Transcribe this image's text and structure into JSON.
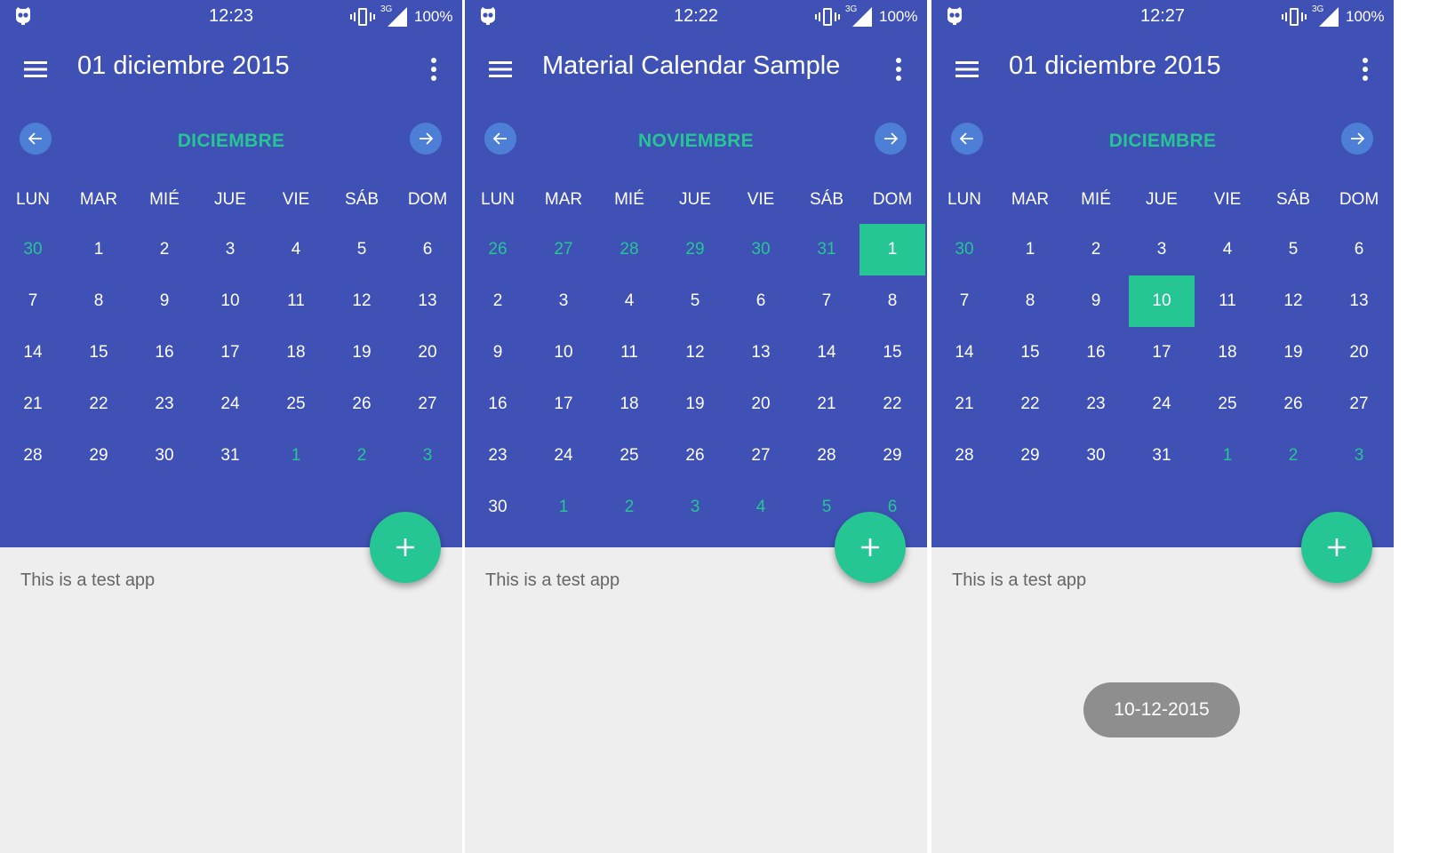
{
  "common": {
    "battery": "100%",
    "network_type": "3G",
    "weekdays": [
      "LUN",
      "MAR",
      "MIÉ",
      "JUE",
      "VIE",
      "SÁB",
      "DOM"
    ],
    "content_text": "This is a test app",
    "fab_label": "+",
    "colors": {
      "primary": "#3f51b5",
      "accent": "#26c694",
      "nav_button": "#4d7fd6",
      "content_background": "#eeeeee",
      "content_text": "#666666",
      "toast_background": "#8e8e8e"
    },
    "icons": {
      "status_app": "ghost-icon",
      "vibrate": "vibrate-icon",
      "signal": "signal-3g-icon",
      "menu": "hamburger-menu-icon",
      "overflow": "more-vert-icon",
      "prev_month": "arrow-left-icon",
      "next_month": "arrow-right-icon",
      "fab": "plus-icon"
    }
  },
  "screens": [
    {
      "status_time": "12:23",
      "toolbar_title": "01 diciembre 2015",
      "month_title": "DICIEMBRE",
      "selected_day": null,
      "toast": null,
      "weeks": [
        [
          {
            "d": "30",
            "o": true
          },
          {
            "d": "1"
          },
          {
            "d": "2"
          },
          {
            "d": "3"
          },
          {
            "d": "4"
          },
          {
            "d": "5"
          },
          {
            "d": "6"
          }
        ],
        [
          {
            "d": "7"
          },
          {
            "d": "8"
          },
          {
            "d": "9"
          },
          {
            "d": "10"
          },
          {
            "d": "11"
          },
          {
            "d": "12"
          },
          {
            "d": "13"
          }
        ],
        [
          {
            "d": "14"
          },
          {
            "d": "15"
          },
          {
            "d": "16"
          },
          {
            "d": "17"
          },
          {
            "d": "18"
          },
          {
            "d": "19"
          },
          {
            "d": "20"
          }
        ],
        [
          {
            "d": "21"
          },
          {
            "d": "22"
          },
          {
            "d": "23"
          },
          {
            "d": "24"
          },
          {
            "d": "25"
          },
          {
            "d": "26"
          },
          {
            "d": "27"
          }
        ],
        [
          {
            "d": "28"
          },
          {
            "d": "29"
          },
          {
            "d": "30"
          },
          {
            "d": "31"
          },
          {
            "d": "1",
            "o": true
          },
          {
            "d": "2",
            "o": true
          },
          {
            "d": "3",
            "o": true
          }
        ]
      ]
    },
    {
      "status_time": "12:22",
      "toolbar_title": "Material Calendar Sample",
      "month_title": "NOVIEMBRE",
      "selected_day": "1",
      "toast": null,
      "weeks": [
        [
          {
            "d": "26",
            "o": true
          },
          {
            "d": "27",
            "o": true
          },
          {
            "d": "28",
            "o": true
          },
          {
            "d": "29",
            "o": true
          },
          {
            "d": "30",
            "o": true
          },
          {
            "d": "31",
            "o": true
          },
          {
            "d": "1",
            "s": true
          }
        ],
        [
          {
            "d": "2"
          },
          {
            "d": "3"
          },
          {
            "d": "4"
          },
          {
            "d": "5"
          },
          {
            "d": "6"
          },
          {
            "d": "7"
          },
          {
            "d": "8"
          }
        ],
        [
          {
            "d": "9"
          },
          {
            "d": "10"
          },
          {
            "d": "11"
          },
          {
            "d": "12"
          },
          {
            "d": "13"
          },
          {
            "d": "14"
          },
          {
            "d": "15"
          }
        ],
        [
          {
            "d": "16"
          },
          {
            "d": "17"
          },
          {
            "d": "18"
          },
          {
            "d": "19"
          },
          {
            "d": "20"
          },
          {
            "d": "21"
          },
          {
            "d": "22"
          }
        ],
        [
          {
            "d": "23"
          },
          {
            "d": "24"
          },
          {
            "d": "25"
          },
          {
            "d": "26"
          },
          {
            "d": "27"
          },
          {
            "d": "28"
          },
          {
            "d": "29"
          }
        ],
        [
          {
            "d": "30"
          },
          {
            "d": "1",
            "o": true
          },
          {
            "d": "2",
            "o": true
          },
          {
            "d": "3",
            "o": true
          },
          {
            "d": "4",
            "o": true
          },
          {
            "d": "5",
            "o": true
          },
          {
            "d": "6",
            "o": true
          }
        ]
      ]
    },
    {
      "status_time": "12:27",
      "toolbar_title": "01 diciembre 2015",
      "month_title": "DICIEMBRE",
      "selected_day": "10",
      "toast": "10-12-2015",
      "weeks": [
        [
          {
            "d": "30",
            "o": true
          },
          {
            "d": "1"
          },
          {
            "d": "2"
          },
          {
            "d": "3"
          },
          {
            "d": "4"
          },
          {
            "d": "5"
          },
          {
            "d": "6"
          }
        ],
        [
          {
            "d": "7"
          },
          {
            "d": "8"
          },
          {
            "d": "9"
          },
          {
            "d": "10",
            "s": true
          },
          {
            "d": "11"
          },
          {
            "d": "12"
          },
          {
            "d": "13"
          }
        ],
        [
          {
            "d": "14"
          },
          {
            "d": "15"
          },
          {
            "d": "16"
          },
          {
            "d": "17"
          },
          {
            "d": "18"
          },
          {
            "d": "19"
          },
          {
            "d": "20"
          }
        ],
        [
          {
            "d": "21"
          },
          {
            "d": "22"
          },
          {
            "d": "23"
          },
          {
            "d": "24"
          },
          {
            "d": "25"
          },
          {
            "d": "26"
          },
          {
            "d": "27"
          }
        ],
        [
          {
            "d": "28"
          },
          {
            "d": "29"
          },
          {
            "d": "30"
          },
          {
            "d": "31"
          },
          {
            "d": "1",
            "o": true
          },
          {
            "d": "2",
            "o": true
          },
          {
            "d": "3",
            "o": true
          }
        ]
      ]
    }
  ]
}
